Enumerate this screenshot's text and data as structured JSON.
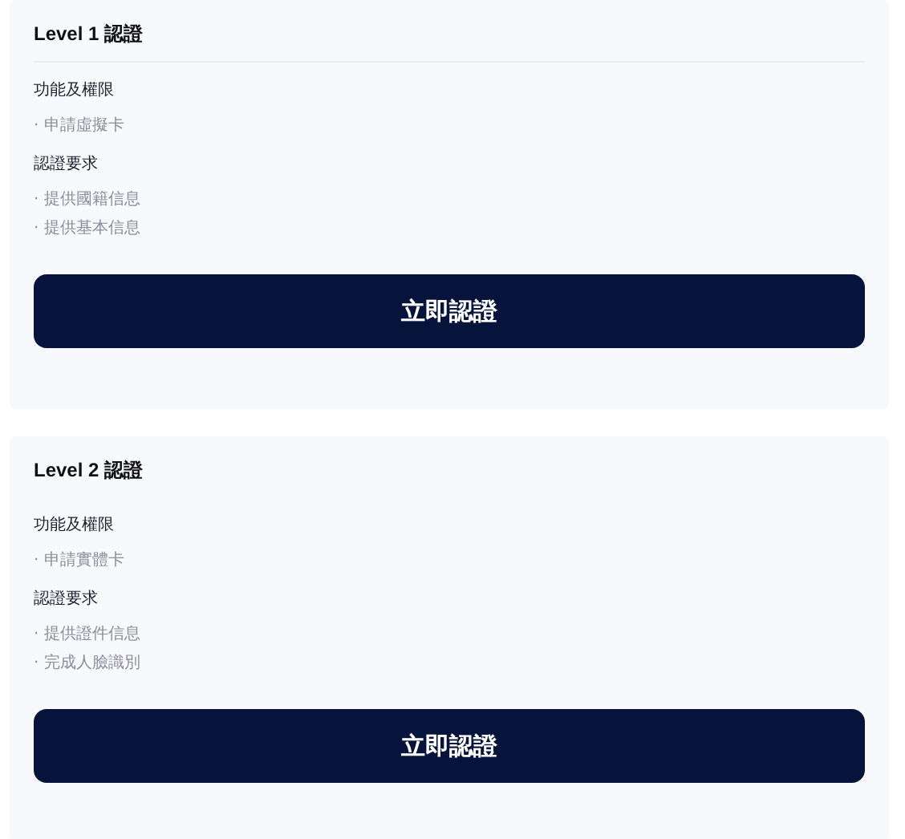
{
  "cards": [
    {
      "title": "Level 1 認證",
      "divider": true,
      "sections": [
        {
          "heading": "功能及權限",
          "items": [
            "· 申請虛擬卡"
          ]
        },
        {
          "heading": "認證要求",
          "items": [
            "· 提供國籍信息",
            "· 提供基本信息"
          ]
        }
      ],
      "button": "立即認證"
    },
    {
      "title": "Level 2 認證",
      "divider": false,
      "sections": [
        {
          "heading": "功能及權限",
          "items": [
            "· 申請實體卡"
          ]
        },
        {
          "heading": "認證要求",
          "items": [
            "· 提供證件信息",
            "· 完成人臉識別"
          ]
        }
      ],
      "button": "立即認證"
    }
  ]
}
